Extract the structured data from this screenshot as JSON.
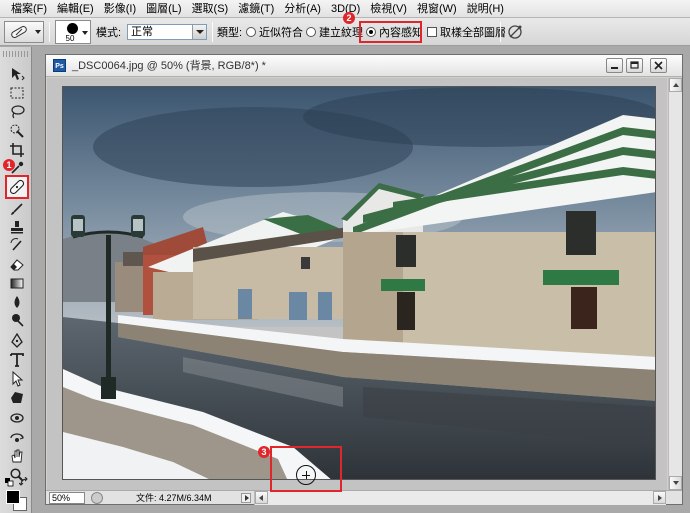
{
  "menu": [
    {
      "label": "檔案(F)"
    },
    {
      "label": "編輯(E)"
    },
    {
      "label": "影像(I)"
    },
    {
      "label": "圖層(L)"
    },
    {
      "label": "選取(S)"
    },
    {
      "label": "濾鏡(T)"
    },
    {
      "label": "分析(A)"
    },
    {
      "label": "3D(D)"
    },
    {
      "label": "檢視(V)"
    },
    {
      "label": "視窗(W)"
    },
    {
      "label": "說明(H)"
    }
  ],
  "options": {
    "brush_size": "50",
    "mode_label": "模式:",
    "mode_value": "正常",
    "type_label": "類型:",
    "radio_proximity": "近似符合",
    "radio_texture": "建立紋理",
    "radio_content_aware": "內容感知",
    "sample_all_layers": "取樣全部圖層"
  },
  "badges": {
    "one": "1",
    "two": "2",
    "three": "3"
  },
  "document": {
    "ps_icon": "Ps",
    "title": "_DSC0064.jpg @ 50% (背景, RGB/8*) *",
    "zoom": "50%",
    "doc_size": "文件: 4.27M/6.34M"
  },
  "colors": {
    "highlight": "#e0262a",
    "foreground": "#000000",
    "background": "#ffffff"
  }
}
